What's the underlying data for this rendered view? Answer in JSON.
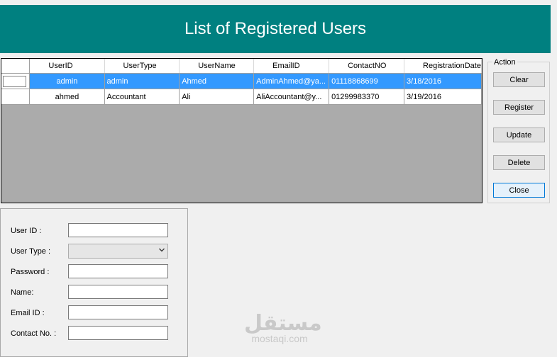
{
  "header": {
    "title": "List of Registered Users"
  },
  "grid": {
    "columns": [
      "UserID",
      "UserType",
      "UserName",
      "EmailID",
      "ContactNO",
      "RegistrationDate"
    ],
    "rows": [
      {
        "UserID": "admin",
        "UserType": "admin",
        "UserName": "Ahmed",
        "EmailID": "AdminAhmed@ya...",
        "ContactNO": "01118868699",
        "RegistrationDate": "3/18/2016",
        "selected": true
      },
      {
        "UserID": "ahmed",
        "UserType": "Accountant",
        "UserName": "Ali",
        "EmailID": "AliAccountant@y...",
        "ContactNO": "01299983370",
        "RegistrationDate": "3/19/2016",
        "selected": false
      }
    ]
  },
  "action": {
    "legend": "Action",
    "buttons": [
      "Clear",
      "Register",
      "Update",
      "Delete",
      "Close"
    ]
  },
  "form": {
    "fields": [
      {
        "label": "User ID :",
        "value": "",
        "type": "text"
      },
      {
        "label": "User Type :",
        "value": "",
        "type": "select"
      },
      {
        "label": "Password :",
        "value": "",
        "type": "text"
      },
      {
        "label": "Name:",
        "value": "",
        "type": "text"
      },
      {
        "label": "Email ID :",
        "value": "",
        "type": "text"
      },
      {
        "label": "Contact No. :",
        "value": "",
        "type": "text"
      }
    ]
  },
  "watermark": {
    "arabic": "مستقل",
    "latin": "mostaqi.com"
  },
  "colors": {
    "header": "#008080",
    "selection": "#3399ff",
    "grid_background": "#ababab"
  }
}
